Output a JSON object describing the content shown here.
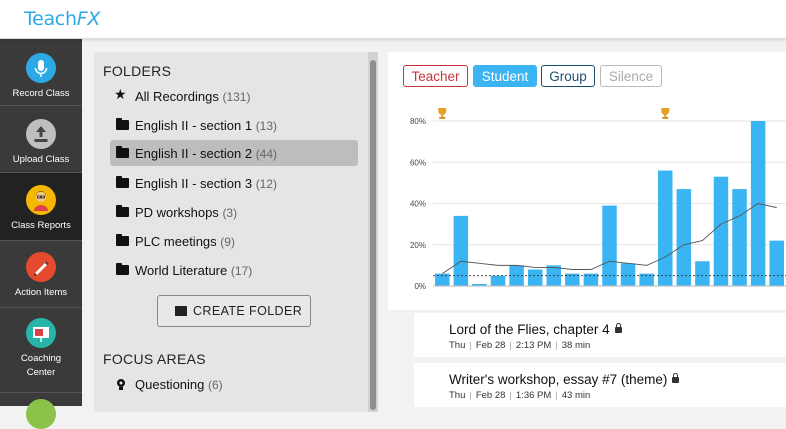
{
  "app": {
    "logo_part1": "Teach",
    "logo_part2": "FX"
  },
  "sidebar": {
    "items": [
      {
        "label": "Record Class",
        "icon": "microphone-icon",
        "color": "#2fa9e6"
      },
      {
        "label": "Upload Class",
        "icon": "upload-icon",
        "color": "#bfbfbf"
      },
      {
        "label": "Class Reports",
        "icon": "teacher-avatar-icon",
        "color": "#f5b700"
      },
      {
        "label": "Action Items",
        "icon": "pencil-icon",
        "color": "#e44a2e"
      },
      {
        "label": "Coaching",
        "label2": "Center",
        "icon": "presentation-board-icon",
        "color": "#26b5a8"
      }
    ]
  },
  "folders": {
    "title": "FOLDERS",
    "items": [
      {
        "label": "All Recordings",
        "count": "(131)",
        "icon": "star-icon"
      },
      {
        "label": "English II - section 1",
        "count": "(13)",
        "icon": "folder-icon"
      },
      {
        "label": "English II - section 2",
        "count": "(44)",
        "icon": "folder-icon"
      },
      {
        "label": "English II - section 3",
        "count": "(12)",
        "icon": "folder-icon"
      },
      {
        "label": "PD workshops",
        "count": "(3)",
        "icon": "folder-icon"
      },
      {
        "label": "PLC meetings",
        "count": "(9)",
        "icon": "folder-icon"
      },
      {
        "label": "World Literature",
        "count": "(17)",
        "icon": "folder-icon"
      }
    ],
    "create_button": "CREATE FOLDER"
  },
  "focus_areas": {
    "title": "FOCUS AREAS",
    "items": [
      {
        "label": "Questioning",
        "count": "(6)",
        "icon": "focus-area-icon"
      }
    ]
  },
  "filters": [
    {
      "label": "Teacher",
      "color": "#c9343b",
      "active": false
    },
    {
      "label": "Student",
      "color": "#3ab4f2",
      "active": true
    },
    {
      "label": "Group",
      "color": "#1c4e72",
      "active": false
    },
    {
      "label": "Silence",
      "color": "#aaaaaa",
      "active": false
    }
  ],
  "chart_data": {
    "type": "bar",
    "yticks": [
      "0%",
      "20%",
      "40%",
      "60%",
      "80%"
    ],
    "ylim": [
      0,
      80
    ],
    "series": [
      {
        "type": "bar",
        "color": "#3ab4f2",
        "values": [
          6,
          34,
          1,
          5,
          10,
          8,
          10,
          6,
          6,
          39,
          11,
          6,
          56,
          47,
          12,
          53,
          47,
          80,
          22
        ]
      },
      {
        "type": "line",
        "color": "#555555",
        "values": [
          6,
          12,
          11,
          10,
          10,
          9,
          9,
          8,
          8,
          12,
          11,
          10,
          14,
          20,
          22,
          30,
          34,
          40,
          38
        ]
      }
    ],
    "reference_line": 5,
    "markers": [
      {
        "icon": "trophy-icon",
        "index": 0
      },
      {
        "icon": "trophy-icon",
        "index": 12
      }
    ]
  },
  "recordings": [
    {
      "title": "Lord of the Flies, chapter 4",
      "day": "Thu",
      "date": "Feb 28",
      "time": "2:13 PM",
      "duration": "38 min"
    },
    {
      "title": "Writer's workshop, essay #7 (theme)",
      "day": "Thu",
      "date": "Feb 28",
      "time": "1:36 PM",
      "duration": "43 min"
    }
  ]
}
